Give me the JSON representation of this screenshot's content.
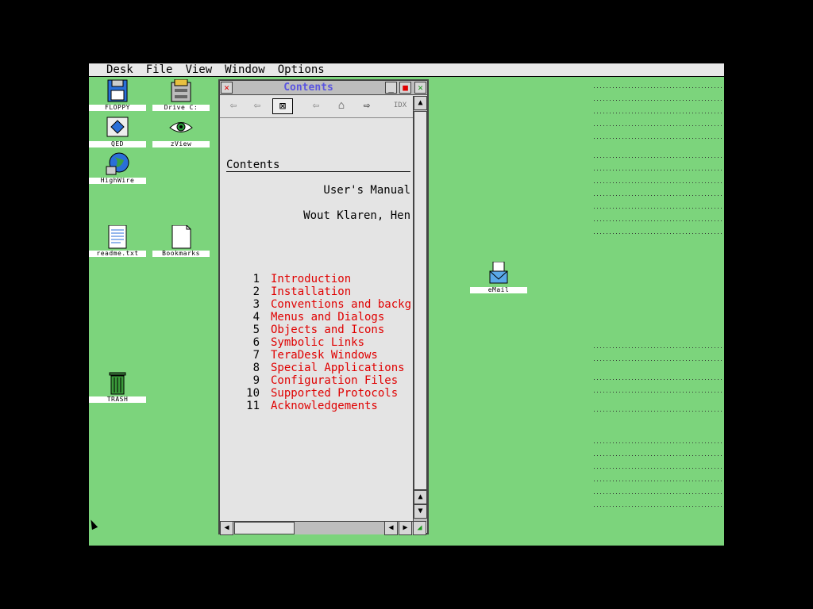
{
  "menubar": {
    "items": [
      "Desk",
      "File",
      "View",
      "Window",
      "Options"
    ]
  },
  "desktop": {
    "icons": [
      {
        "label": "FLOPPY",
        "icon": "floppy-disk-icon"
      },
      {
        "label": "Drive C:",
        "icon": "drive-icon"
      },
      {
        "label": "QED",
        "icon": "qed-app-icon"
      },
      {
        "label": "zView",
        "icon": "eye-icon"
      },
      {
        "label": "HighWire",
        "icon": "globe-icon"
      },
      {
        "label": "readme.txt",
        "icon": "text-file-icon"
      },
      {
        "label": "Bookmarks",
        "icon": "file-icon"
      },
      {
        "label": "TRASH",
        "icon": "trash-icon"
      },
      {
        "label": "eMail",
        "icon": "mail-icon"
      }
    ]
  },
  "window": {
    "title": "Contents",
    "toolbar_icons": [
      "back-icon",
      "index-back-icon",
      "close-doc-icon",
      "prev-icon",
      "home-icon",
      "next-icon",
      "index-icon"
    ],
    "content": {
      "heading": "Contents",
      "manual_title": "User's Manual",
      "authors": "Wout Klaren, Hen",
      "toc": [
        {
          "num": "1",
          "label": "Introduction"
        },
        {
          "num": "2",
          "label": "Installation"
        },
        {
          "num": "3",
          "label": "Conventions and backgr"
        },
        {
          "num": "4",
          "label": "Menus and Dialogs"
        },
        {
          "num": "5",
          "label": "Objects and Icons"
        },
        {
          "num": "6",
          "label": "Symbolic Links"
        },
        {
          "num": "7",
          "label": "TeraDesk Windows"
        },
        {
          "num": "8",
          "label": "Special Applications"
        },
        {
          "num": "9",
          "label": "Configuration Files"
        },
        {
          "num": "10",
          "label": "Supported Protocols"
        },
        {
          "num": "11",
          "label": "Acknowledgements"
        }
      ]
    }
  },
  "colors": {
    "desktop": "#86dd86",
    "link": "#e00000",
    "title": "#5a55e0"
  }
}
